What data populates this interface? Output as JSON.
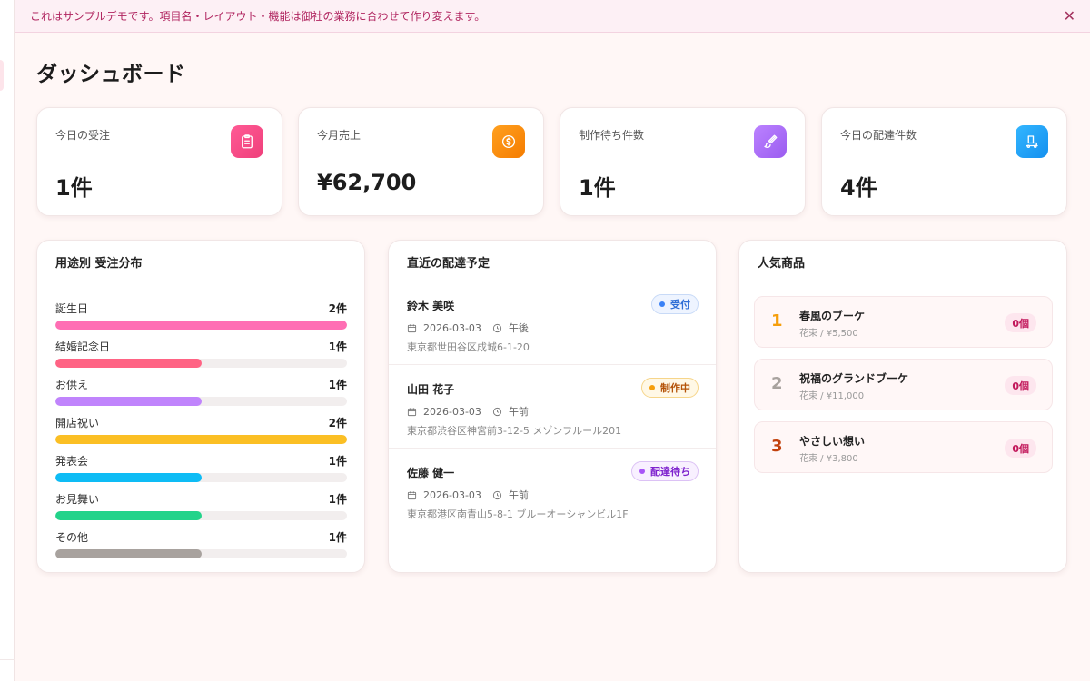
{
  "banner": {
    "text": "これはサンプルデモです。項目名・レイアウト・機能は御社の業務に合わせて作り変えます。",
    "close_label": "✕"
  },
  "page_title": "ダッシュボード",
  "stats": [
    {
      "label": "今日の受注",
      "value": "1件",
      "icon": "clipboard-icon",
      "color_from": "#ff4f8b",
      "color_to": "#f0447e"
    },
    {
      "label": "今月売上",
      "value": "¥62,700",
      "icon": "coin-icon",
      "color_from": "#ff9a1a",
      "color_to": "#f57c00"
    },
    {
      "label": "制作待ち件数",
      "value": "1件",
      "icon": "brush-icon",
      "color_from": "#b57bff",
      "color_to": "#9c5ef0"
    },
    {
      "label": "今日の配達件数",
      "value": "4件",
      "icon": "truck-icon",
      "color_from": "#2bb0ff",
      "color_to": "#1591f0"
    }
  ],
  "distribution": {
    "title": "用途別 受注分布",
    "items": [
      {
        "name": "誕生日",
        "count": "2件",
        "ratio": 1.0,
        "color": "#ff6eb4"
      },
      {
        "name": "結婚記念日",
        "count": "1件",
        "ratio": 0.5,
        "color": "#ff6384"
      },
      {
        "name": "お供え",
        "count": "1件",
        "ratio": 0.5,
        "color": "#c084fc"
      },
      {
        "name": "開店祝い",
        "count": "2件",
        "ratio": 1.0,
        "color": "#fbbf24"
      },
      {
        "name": "発表会",
        "count": "1件",
        "ratio": 0.5,
        "color": "#0ebcf5"
      },
      {
        "name": "お見舞い",
        "count": "1件",
        "ratio": 0.5,
        "color": "#22d38a"
      },
      {
        "name": "その他",
        "count": "1件",
        "ratio": 0.5,
        "color": "#a8a29e"
      }
    ]
  },
  "deliveries": {
    "title": "直近の配達予定",
    "items": [
      {
        "name": "鈴木 美咲",
        "date": "2026-03-03",
        "time": "午後",
        "address": "東京都世田谷区成城6-1-20",
        "status": "受付",
        "status_color": "#2f6fd6",
        "status_bg": "#eef4ff",
        "status_border": "#c8daf7",
        "dot_color": "#3b82f6"
      },
      {
        "name": "山田 花子",
        "date": "2026-03-03",
        "time": "午前",
        "address": "東京都渋谷区神宮前3-12-5 メゾンフルール201",
        "status": "制作中",
        "status_color": "#b45309",
        "status_bg": "#fff8e6",
        "status_border": "#f6d58a",
        "dot_color": "#f59e0b"
      },
      {
        "name": "佐藤 健一",
        "date": "2026-03-03",
        "time": "午前",
        "address": "東京都港区南青山5-8-1 ブルーオーシャンビル1F",
        "status": "配達待ち",
        "status_color": "#7e22ce",
        "status_bg": "#f8f0ff",
        "status_border": "#dcc2f5",
        "dot_color": "#a855f7"
      }
    ]
  },
  "popular": {
    "title": "人気商品",
    "items": [
      {
        "rank": "1",
        "name": "春風のブーケ",
        "sub": "花束 / ¥5,500",
        "count": "0個",
        "rank_color": "#f59e0b"
      },
      {
        "rank": "2",
        "name": "祝福のグランドブーケ",
        "sub": "花束 / ¥11,000",
        "count": "0個",
        "rank_color": "#a8a29e"
      },
      {
        "rank": "3",
        "name": "やさしい想い",
        "sub": "花束 / ¥3,800",
        "count": "0個",
        "rank_color": "#c2410c"
      }
    ]
  }
}
